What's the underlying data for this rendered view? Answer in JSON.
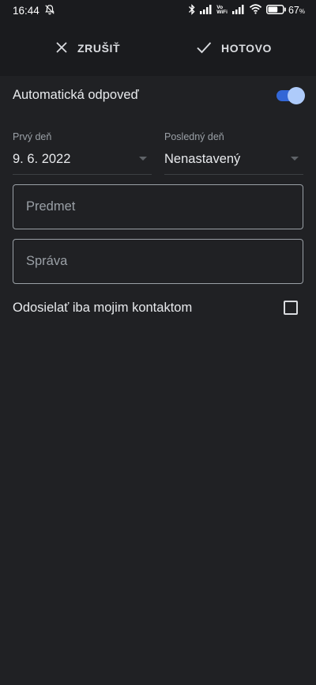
{
  "status_bar": {
    "time": "16:44",
    "vo": "Vo",
    "wifi_label": "WiFi",
    "battery_percent": "67",
    "battery_unit": "%",
    "battery_level": 0.67,
    "icons": [
      "muted-bell-icon",
      "bluetooth-icon",
      "signal-icon",
      "wifi-icon",
      "battery-icon"
    ]
  },
  "toolbar": {
    "cancel_label": "ZRUŠIŤ",
    "done_label": "HOTOVO"
  },
  "auto_reply": {
    "label": "Automatická odpoveď",
    "enabled": true
  },
  "dates": {
    "first_day_label": "Prvý deň",
    "first_day_value": "9. 6. 2022",
    "last_day_label": "Posledný deň",
    "last_day_value": "Nenastavený"
  },
  "subject": {
    "placeholder": "Predmet",
    "value": ""
  },
  "message": {
    "placeholder": "Správa",
    "value": ""
  },
  "contacts_only": {
    "label": "Odosielať iba mojim kontaktom",
    "checked": false
  },
  "colors": {
    "background": "#202124",
    "bar_background": "#1a1b1e",
    "toggle_track": "#3367d6",
    "toggle_thumb": "#aecbfa"
  }
}
